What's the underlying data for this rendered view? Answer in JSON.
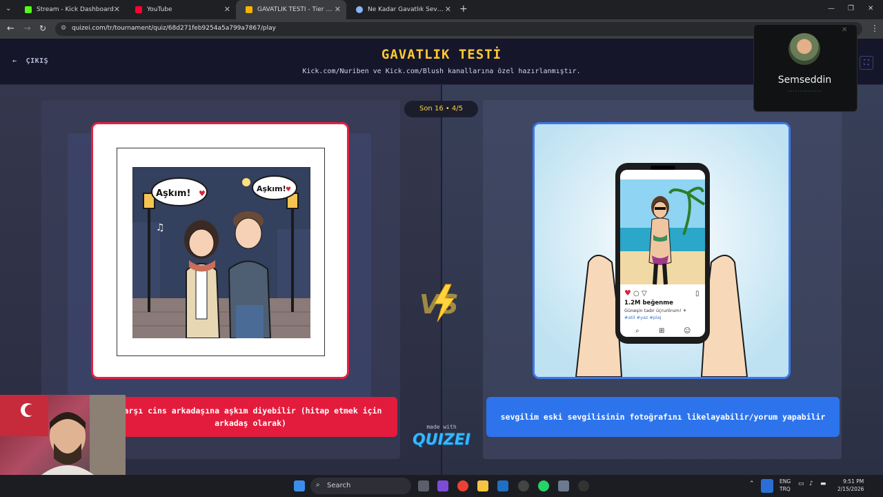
{
  "browser": {
    "tabs": [
      {
        "title": "Stream - Kick Dashboard",
        "favicon_color": "#53fc18"
      },
      {
        "title": "YouTube",
        "favicon_color": "#ff0033"
      },
      {
        "title": "GAVATLIK TESTİ - Tier List, Kör",
        "favicon_color": "#f4b400",
        "active": true
      },
      {
        "title": "Ne Kadar Gavatlık Seviyesinde",
        "favicon_color": "#8ab4f8"
      }
    ],
    "url": "quizei.com/tr/tournament/quiz/68d271feb9254a5a799a7867/play"
  },
  "quiz": {
    "exit_label": "ÇIKIŞ",
    "title": "GAVATLIK TESTİ",
    "subtitle": "Kick.com/Nuriben ve Kick.com/Blush kanallarına özel hazırlanmıştır.",
    "round": "Son 16 • 4/5",
    "left_option": "karşı cins arkadaşına aşkım diyebilir (hitap etmek için arkadaş olarak)",
    "right_option": "sevgilim eski sevgilisinin fotoğrafını likelayabilir/yorum yapabilir",
    "left_bubble_1": "Aşkım!",
    "left_bubble_2": "Aşkım!",
    "phone_likes": "1.2M beğenme",
    "phone_caption": "Güneşin tadır üçrurörum! ☀",
    "phone_tags": "#atil #yaz #plaj",
    "made_with": "made with",
    "brand": "QUIZEI",
    "vs": "VS"
  },
  "call": {
    "name": "Semseddin"
  },
  "taskbar": {
    "search_placeholder": "Search",
    "lang_1": "ENG",
    "lang_2": "TRQ",
    "time": "9:51 PM",
    "date": "2/15/2026"
  },
  "colors": {
    "accent_title": "#ffc932",
    "left_red": "#e31c3d",
    "right_blue": "#2d74ec"
  }
}
